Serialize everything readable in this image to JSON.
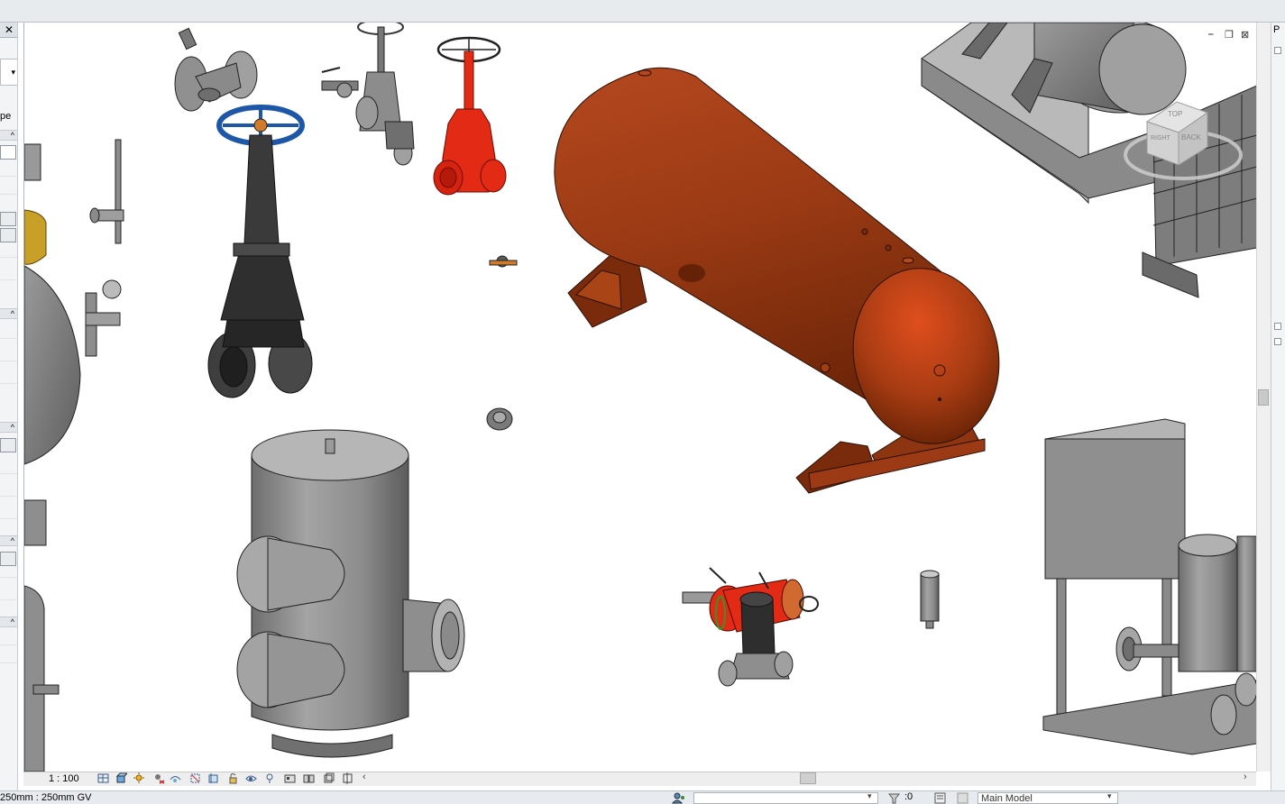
{
  "left_panel": {
    "close_label": "✕",
    "type_label_fragment": "pe",
    "dropdown_arrow": "▾"
  },
  "right_panel": {
    "label_fragment": "P"
  },
  "viewport": {
    "window_controls": {
      "minimize": "⎯",
      "restore": "❐",
      "close": "⊠"
    },
    "viewcube": {
      "face_top": "TOP",
      "face_back": "BACK",
      "face_right": "RIGHT"
    }
  },
  "view_control_bar": {
    "scale": "1 : 100",
    "icons": [
      "detail-level-icon",
      "visual-style-icon",
      "sun-path-icon",
      "shadows-icon",
      "rendering-icon",
      "crop-view-icon",
      "show-crop-icon",
      "unlock-3d-icon",
      "temporary-hide-icon",
      "reveal-hidden-icon",
      "worksharing-icon",
      "design-options-icon",
      "analysis-icon",
      "highlight-displacement-icon",
      "constraints-icon"
    ]
  },
  "status_bar": {
    "text": "250mm : 250mm GV",
    "count": ":0",
    "model": "Main Model"
  },
  "colors": {
    "equipment_gray": "#8c8c8c",
    "tank_orange": "#a8401a",
    "valve_red": "#e22a14",
    "handwheel_blue": "#1e57a8"
  }
}
